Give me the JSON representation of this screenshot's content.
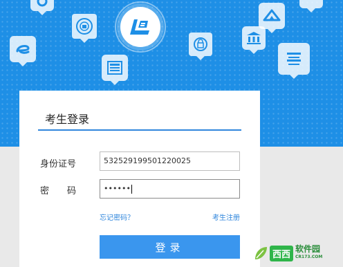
{
  "login_card": {
    "title": "考生登录",
    "id_label": "身份证号",
    "id_value": "532529199501220025",
    "password_label": "密　　码",
    "password_value": "••••••",
    "forgot_password": "忘记密码？",
    "register": "考生注册",
    "login_button": "登录"
  },
  "watermark": {
    "brand": "西西",
    "text": "软件园",
    "url": "CR173.COM"
  },
  "icons": {
    "logo": "exam-logo-icon",
    "float": [
      "map-pin-icon",
      "speech-icon",
      "seal-icon",
      "document-icon",
      "lock-icon",
      "building-icon",
      "mountain-icon",
      "list-icon"
    ]
  },
  "colors": {
    "hero_blue": "#1e8fe6",
    "accent": "#2f86dc",
    "button": "#3a96ee"
  }
}
